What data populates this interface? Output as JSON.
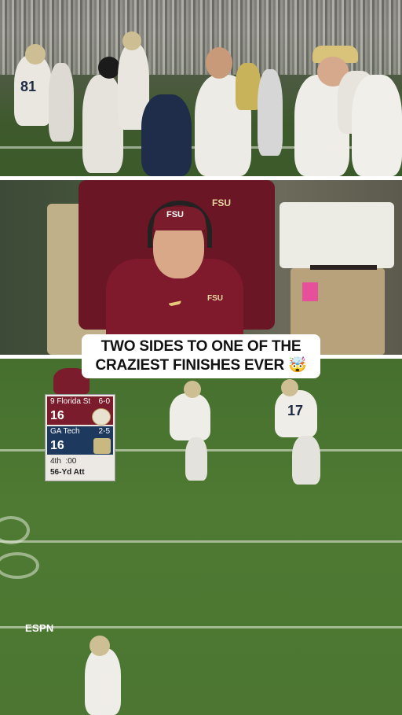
{
  "caption": {
    "text": "TWO SIDES TO ONE OF THE CRAZIEST FINISHES EVER 🤯"
  },
  "scoreboard": {
    "team1_rank": "9",
    "team1_name": "Florida St",
    "team1_record": "6-0",
    "team1_score": "16",
    "team2_name": "GA Tech",
    "team2_record": "2-5",
    "team2_score": "16",
    "quarter": "4th",
    "clock": ":00",
    "situation": "56-Yd Att",
    "team1_color": "#7a1c2b",
    "team2_color": "#1d3a5e"
  },
  "network": {
    "label": "ESPN"
  },
  "panels": {
    "top": {
      "jersey_text": "81"
    },
    "middle": {
      "hat_text": "FSU",
      "jacket_text": "FSU"
    },
    "bottom": {
      "jersey_text": "17"
    }
  }
}
